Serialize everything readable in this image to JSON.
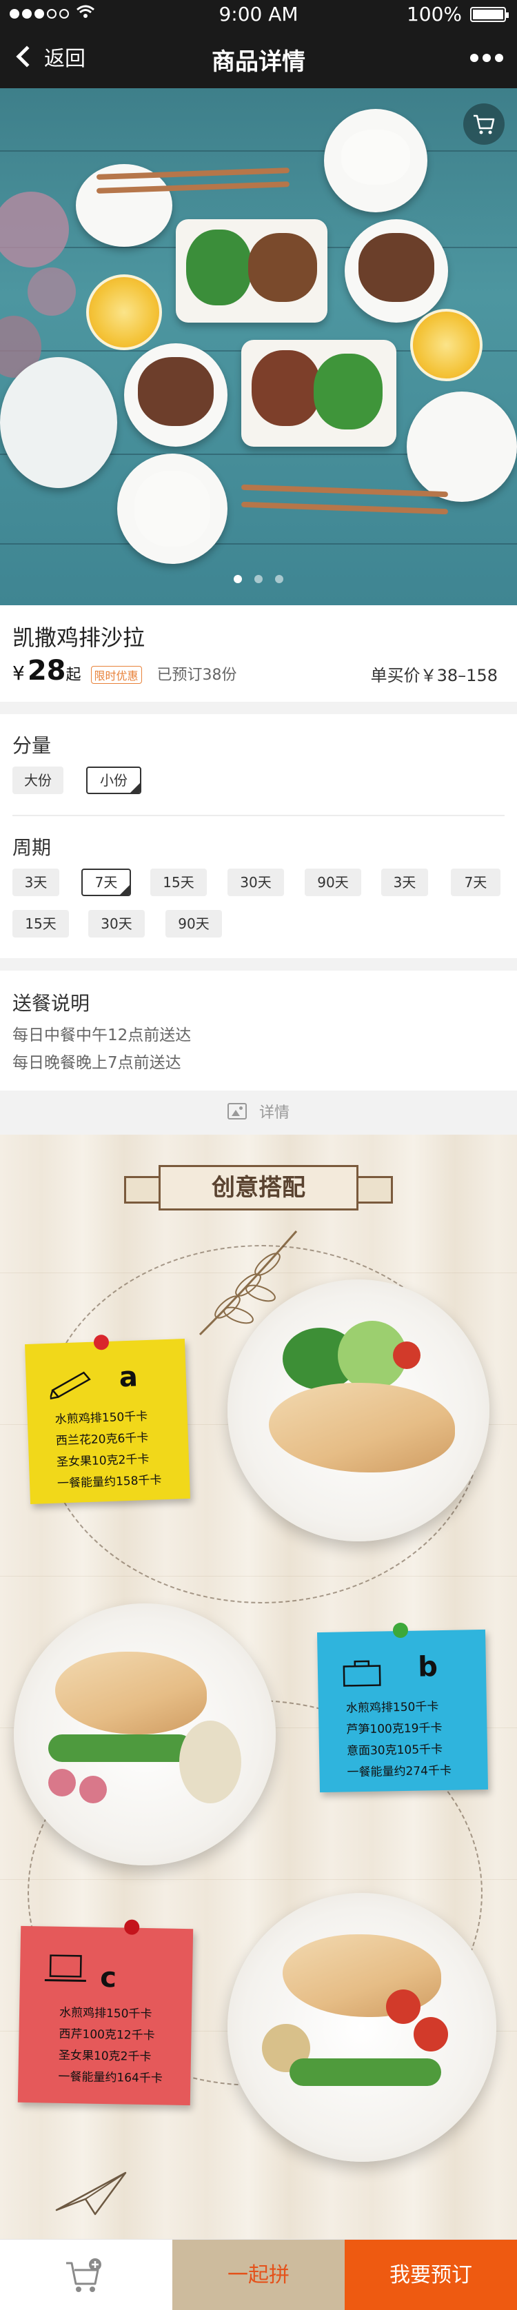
{
  "status_bar": {
    "time": "9:00 AM",
    "battery": "100%"
  },
  "nav": {
    "back_label": "返回",
    "title": "商品详情"
  },
  "hero": {
    "carousel_count": 3,
    "carousel_active": 1
  },
  "product": {
    "name": "凯撒鸡排沙拉",
    "price_symbol": "¥",
    "price": "28",
    "price_suffix": "起",
    "promo_badge": "限时优惠",
    "booked": "已预订38份",
    "unit_price": "单买价￥38–158"
  },
  "portion": {
    "label": "分量",
    "options": [
      "大份",
      "小份"
    ],
    "selected": "小份"
  },
  "cycle": {
    "label": "周期",
    "options": [
      "3天",
      "7天",
      "15天",
      "30天",
      "90天",
      "3天",
      "7天",
      "15天",
      "30天",
      "90天"
    ],
    "selected_index": 1
  },
  "delivery": {
    "title": "送餐说明",
    "lines": [
      "每日中餐中午12点前送达",
      "每日晚餐晚上7点前送达"
    ]
  },
  "detail_tab": {
    "label": "详情"
  },
  "poster": {
    "banner": "创意搭配",
    "notes": [
      {
        "letter": "a",
        "color": "#f1d81a",
        "lines": [
          "水煎鸡排150千卡",
          "西兰花20克6千卡",
          "圣女果10克2千卡",
          "一餐能量约158千卡"
        ]
      },
      {
        "letter": "b",
        "color": "#2fb4dd",
        "lines": [
          "水煎鸡排150千卡",
          "芦笋100克19千卡",
          "意面30克105千卡",
          "一餐能量约274千卡"
        ]
      },
      {
        "letter": "c",
        "color": "#e5595a",
        "lines": [
          "水煎鸡排150千卡",
          "西芹100克12千卡",
          "圣女果10克2千卡",
          "一餐能量约164千卡"
        ]
      }
    ]
  },
  "bottom_bar": {
    "group_label": "一起拼",
    "book_label": "我要预订"
  },
  "colors": {
    "accent": "#ee5a11",
    "group_bg": "#cdbb9d",
    "nav_bg": "#1a1a1a"
  }
}
